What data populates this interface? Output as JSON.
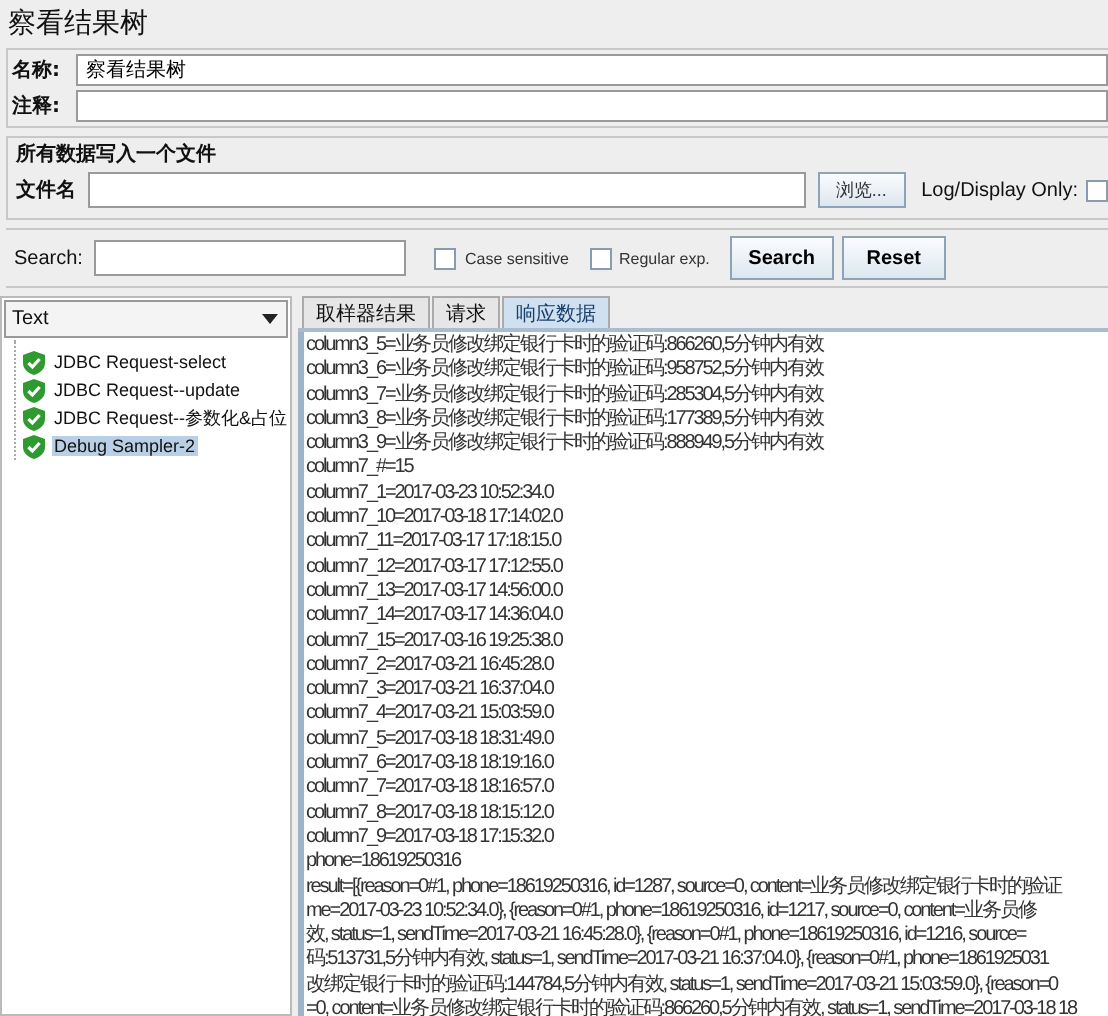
{
  "title": "察看结果树",
  "name_field": {
    "label": "名称:",
    "value": "察看结果树"
  },
  "comment_field": {
    "label": "注释:"
  },
  "file_group": {
    "title": "所有数据写入一个文件",
    "label": "文件名",
    "browse_button": "浏览...",
    "log_display_label": "Log/Display Only:",
    "log_display_checked": false
  },
  "search": {
    "label": "Search:",
    "options": [
      {
        "label": "Case sensitive",
        "checked": false
      },
      {
        "label": "Regular exp.",
        "checked": false
      }
    ],
    "buttons": [
      "Search",
      "Reset"
    ]
  },
  "renderer": {
    "value": "Text"
  },
  "tree": [
    {
      "label": "JDBC Request-select",
      "selected": false
    },
    {
      "label": "JDBC Request--update",
      "selected": false
    },
    {
      "label": "JDBC Request--参数化&占位",
      "selected": false
    },
    {
      "label": "Debug Sampler-2",
      "selected": true
    }
  ],
  "tabs": [
    {
      "label": "取样器结果",
      "selected": false
    },
    {
      "label": "请求",
      "selected": false
    },
    {
      "label": "响应数据",
      "selected": true
    }
  ],
  "response_lines": [
    "column3_5=业务员修改绑定银行卡时的验证码:866260,5分钟内有效",
    "column3_6=业务员修改绑定银行卡时的验证码:958752,5分钟内有效",
    "column3_7=业务员修改绑定银行卡时的验证码:285304,5分钟内有效",
    "column3_8=业务员修改绑定银行卡时的验证码:177389,5分钟内有效",
    "column3_9=业务员修改绑定银行卡时的验证码:888949,5分钟内有效",
    "column7_#=15",
    "column7_1=2017-03-23 10:52:34.0",
    "column7_10=2017-03-18 17:14:02.0",
    "column7_11=2017-03-17 17:18:15.0",
    "column7_12=2017-03-17 17:12:55.0",
    "column7_13=2017-03-17 14:56:00.0",
    "column7_14=2017-03-17 14:36:04.0",
    "column7_15=2017-03-16 19:25:38.0",
    "column7_2=2017-03-21 16:45:28.0",
    "column7_3=2017-03-21 16:37:04.0",
    "column7_4=2017-03-21 15:03:59.0",
    "column7_5=2017-03-18 18:31:49.0",
    "column7_6=2017-03-18 18:19:16.0",
    "column7_7=2017-03-18 18:16:57.0",
    "column7_8=2017-03-18 18:15:12.0",
    "column7_9=2017-03-18 17:15:32.0",
    "phone=18619250316",
    "result=[{reason=0#1, phone=18619250316, id=1287, source=0, content=业务员修改绑定银行卡时的验证",
    "me=2017-03-23 10:52:34.0}, {reason=0#1, phone=18619250316, id=1217, source=0, content=业务员修",
    "效, status=1, sendTime=2017-03-21 16:45:28.0}, {reason=0#1, phone=18619250316, id=1216, source=",
    "码:513731,5分钟内有效, status=1, sendTime=2017-03-21 16:37:04.0}, {reason=0#1, phone=1861925031",
    "改绑定银行卡时的验证码:144784,5分钟内有效, status=1, sendTime=2017-03-21 15:03:59.0}, {reason=0",
    "=0, content=业务员修改绑定银行卡时的验证码:866260,5分钟内有效, status=1, sendTime=2017-03-18 18"
  ]
}
